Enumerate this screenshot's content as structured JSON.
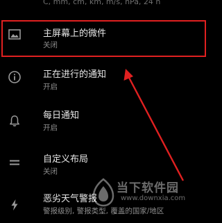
{
  "top_partial_text": "C, mm, cm, km, m/s, hPa, 24 h",
  "settings_items": [
    {
      "icon": "image-icon",
      "title": "主屏幕上的微件",
      "subtitle": "关闭"
    },
    {
      "icon": "info-icon",
      "title": "正在进行的通知",
      "subtitle": "开启"
    },
    {
      "icon": "bell-icon",
      "title": "每日通知",
      "subtitle": "开启"
    },
    {
      "icon": "equals-icon",
      "title": "自定义布局",
      "subtitle": "关闭"
    },
    {
      "icon": "lightning-icon",
      "title": "恶劣天气警报",
      "subtitle": "警报级别, 警报类型, 覆盖的国家/地区"
    }
  ],
  "annotation": {
    "color": "#e02020",
    "highlighted_item": "主屏幕上的微件"
  },
  "watermark": {
    "brand": "当下软件园",
    "url": "www.downxia.com"
  }
}
